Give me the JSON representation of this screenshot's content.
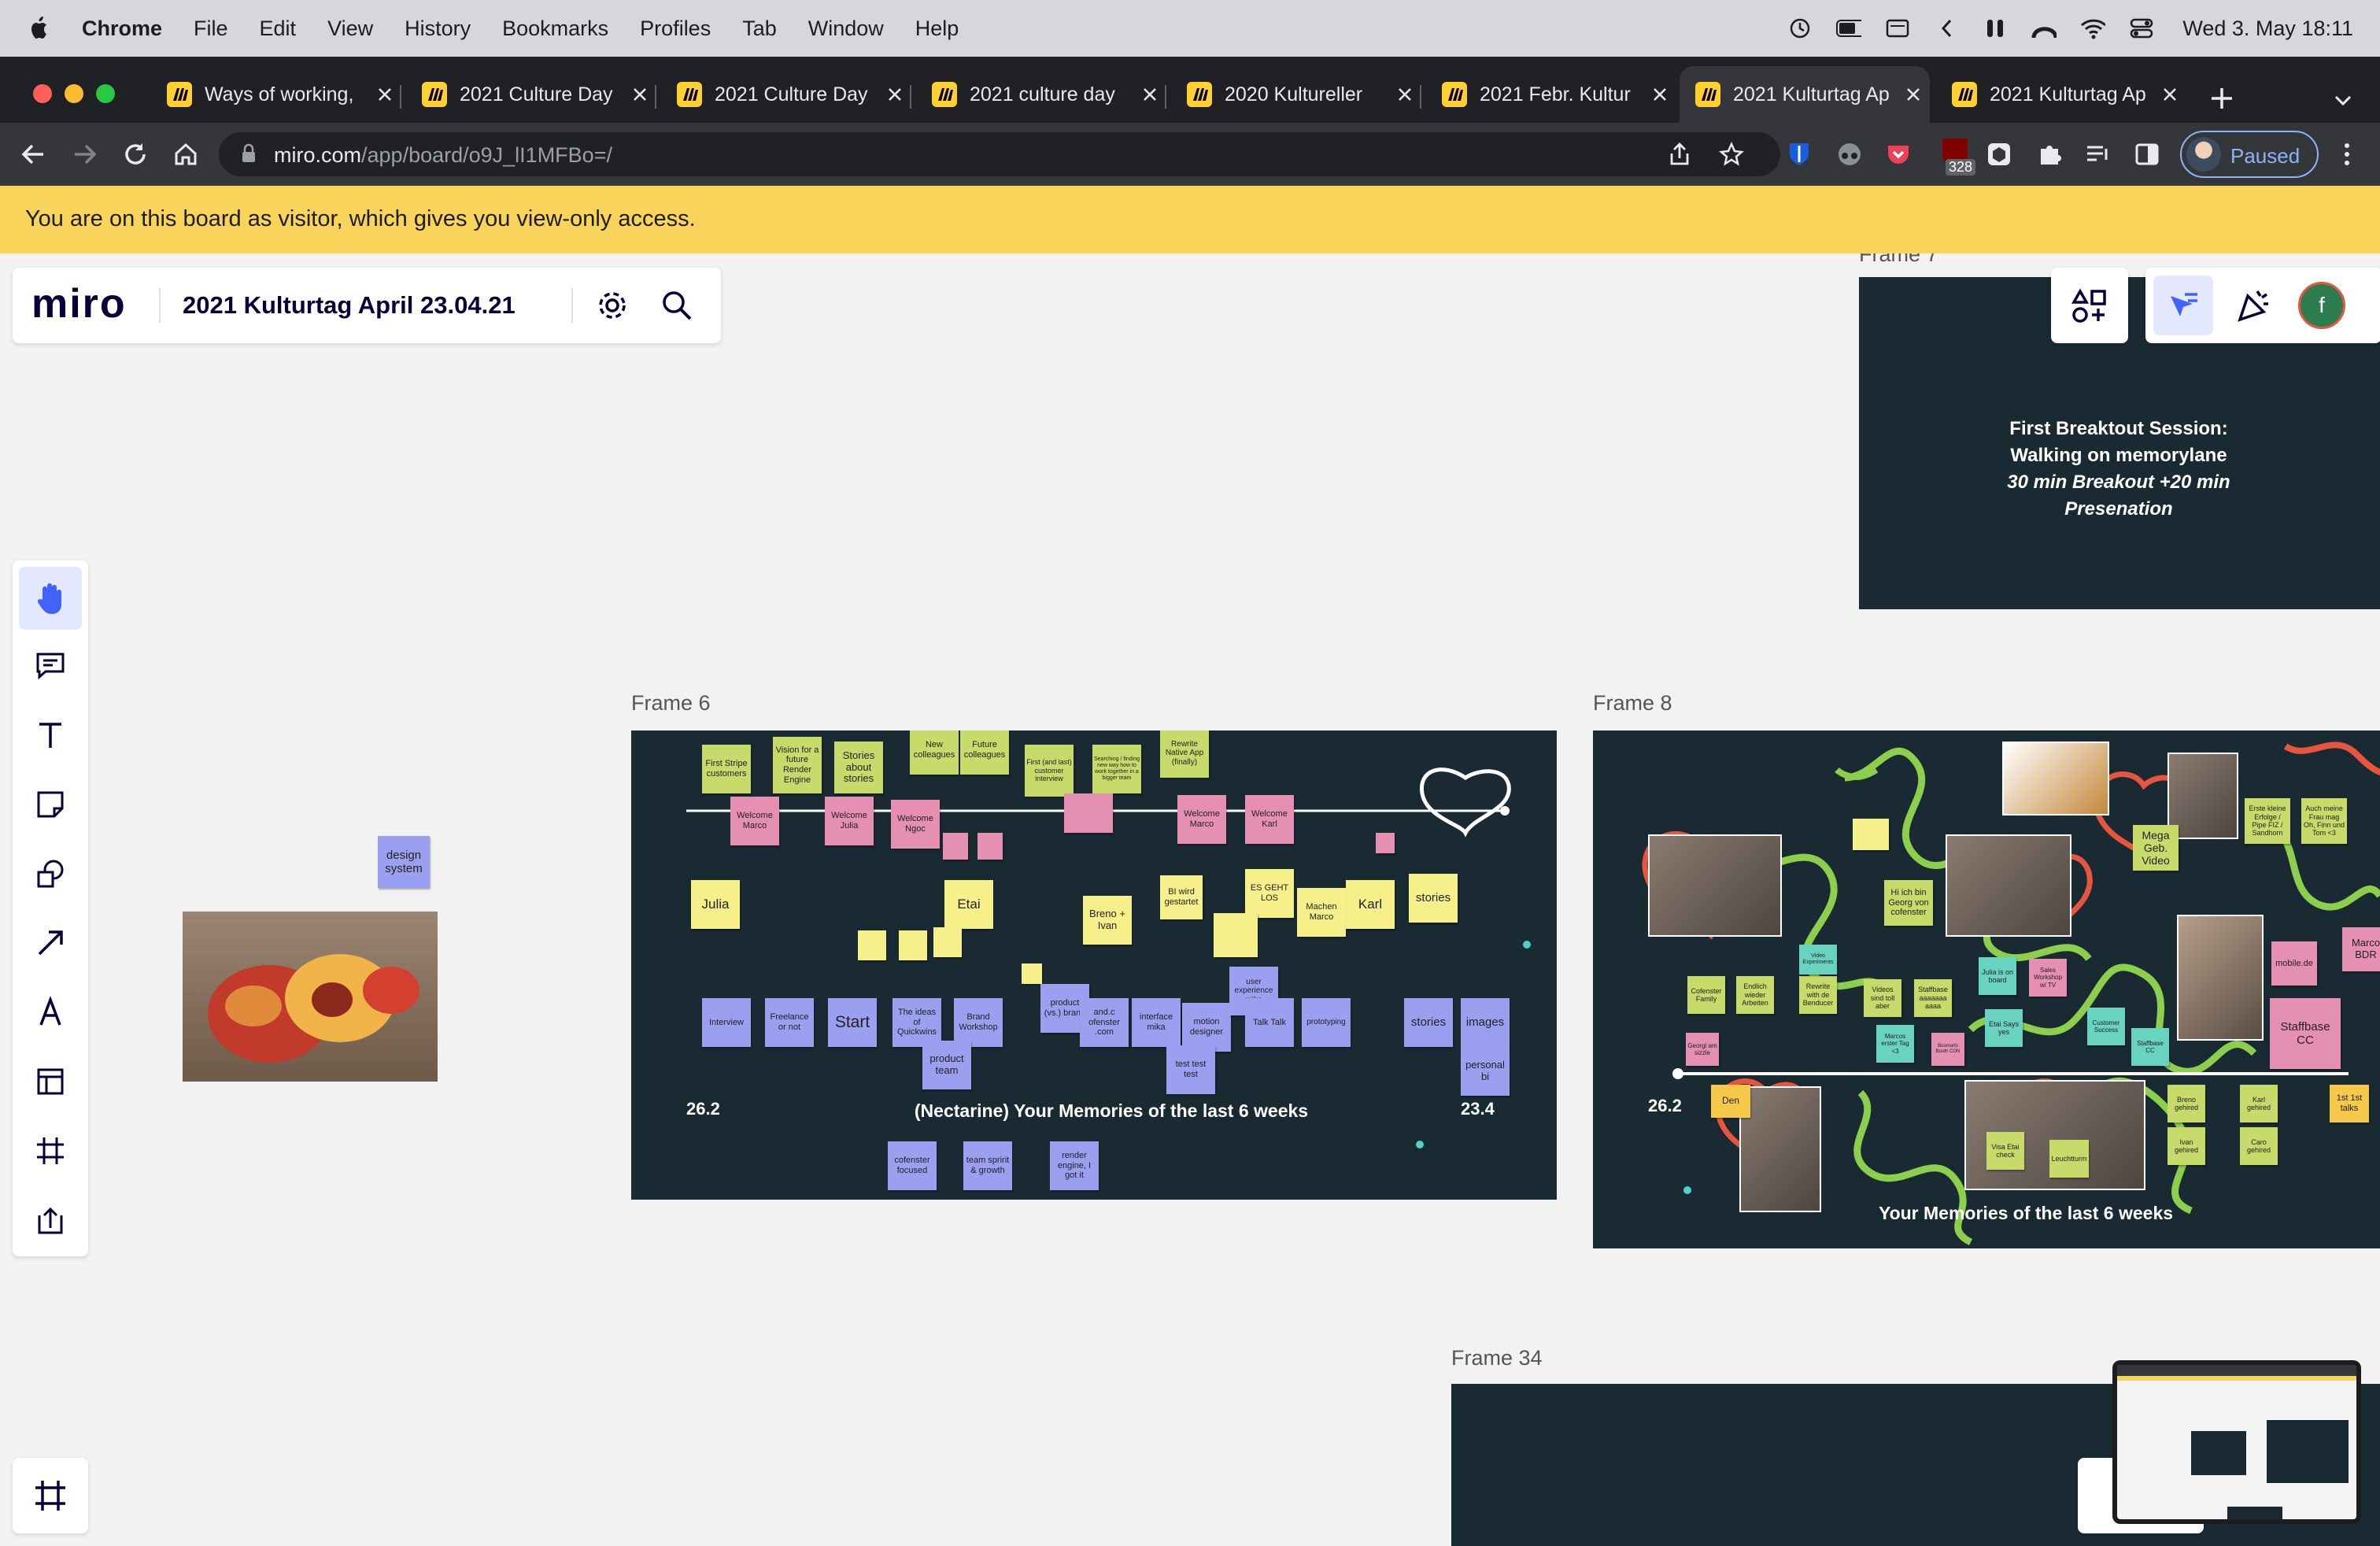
{
  "menubar": {
    "app": "Chrome",
    "items": [
      "File",
      "Edit",
      "View",
      "History",
      "Bookmarks",
      "Profiles",
      "Tab",
      "Window",
      "Help"
    ],
    "datetime": "Wed 3. May  18:11"
  },
  "tabs": [
    {
      "title": "Ways of working,"
    },
    {
      "title": "2021 Culture Day"
    },
    {
      "title": "2021 Culture Day"
    },
    {
      "title": "2021 culture day"
    },
    {
      "title": "2020 Kultureller"
    },
    {
      "title": "2021 Febr. Kultur"
    },
    {
      "title": "2021 Kulturtag Ap",
      "active": true
    },
    {
      "title": "2021 Kulturtag Ap"
    }
  ],
  "toolbar": {
    "url_domain": "miro.com",
    "url_path": "/app/board/o9J_lI1MFBo=/",
    "extension_badge": "328",
    "profile_label": "Paused"
  },
  "banner": {
    "text": "You are on this board as visitor, which gives you view-only access."
  },
  "miro": {
    "logo": "miro",
    "board_title": "2021 Kulturtag April 23.04.21",
    "avatar_letter": "f"
  },
  "canvas": {
    "design_system_note": "design system",
    "frame6": {
      "label": "Frame 6",
      "title": "(Nectarine) Your Memories of the last 6 weeks",
      "start_date": "26.2",
      "end_date": "23.4",
      "notes": [
        "First Stripe customers",
        "Vision for a future Render Engine",
        "Stories about stories",
        "New colleagues",
        "Future colleagues",
        "First (and last) customer interview",
        "Searching / finding new way how to work together in a bigger team",
        "Rewrite Native App (finally)",
        "Welcome Marco",
        "Welcome Julia",
        "Welcome Ngoc",
        "Welcome Marco",
        "Welcome Karl",
        "Julia",
        "Etai",
        "Breno + Ivan",
        "BI wird gestartet",
        "ES GEHT LOS",
        "Machen Marco",
        "Karl",
        "stories",
        "Interview",
        "Freelance or not",
        "Start",
        "The ideas of Quickwins",
        "Brand Workshop",
        "product team",
        "product (vs.) brand",
        "and.c ofenster .com",
        "interface mika",
        "motion designer",
        "user experience mika",
        "Talk Talk",
        "prototyping",
        "test test test",
        "stories",
        "images",
        "personal bi",
        "cofenster focused",
        "team spririt & growth",
        "render engine, I got it"
      ]
    },
    "frame7": {
      "label": "Frame 7",
      "line1": "First Breaktout Session:",
      "line2": "Walking on memorylane",
      "line3": "30 min Breakout +20 min",
      "line4": "Presenation"
    },
    "frame8": {
      "label": "Frame 8",
      "title": "Your Memories of the last 6 weeks",
      "start_date": "26.2",
      "notes": [
        "Mega Geb. Video",
        "Erste kleine Erfolge / Pipe FIZ / Sandhorn",
        "Auch meine Frau mag Oh, Finn und Tom <3",
        "Hi ich bin Georg von cofenster",
        "Cofenster Family",
        "Endlich wieder Arbeiten",
        "Rewrite with de Benducer",
        "Video Experiments",
        "Videos sind toll aber",
        "Staffbase aaaaaaa aaaa",
        "Julia is on board",
        "Sales Workshop w/ TV",
        "Etai Says yes",
        "Customer Success",
        "Staffbase CC",
        "mobile.de",
        "Staffbase CC",
        "Marco BDR",
        "Georgi am sizzle",
        "Marcos erster Tag <3",
        "Boomarts Booth CON",
        "Breno gehired",
        "Ivan gehired",
        "Karl gehired",
        "Caro gehired",
        "Visa Etai check",
        "Leuchtturm",
        "1st 1st talks",
        "Den"
      ]
    },
    "frame34": {
      "label": "Frame 34"
    }
  },
  "colors": {
    "banner": "#f9d45a",
    "frame_bg": "#1a2a32",
    "miro_yellow": "#ffd02f",
    "miro_blue": "#4262ff"
  },
  "icons": [
    "apple-icon",
    "wifi-icon",
    "battery-icon",
    "back-icon",
    "forward-icon",
    "reload-icon",
    "home-icon",
    "lock-icon",
    "share-icon",
    "star-icon",
    "hand-icon",
    "comment-icon",
    "text-icon",
    "sticky-note-icon",
    "shapes-icon",
    "arrow-icon",
    "pen-icon",
    "template-icon",
    "frame-icon",
    "upload-icon",
    "settings-icon",
    "search-icon",
    "apps-icon",
    "cursor-icon",
    "party-icon"
  ]
}
